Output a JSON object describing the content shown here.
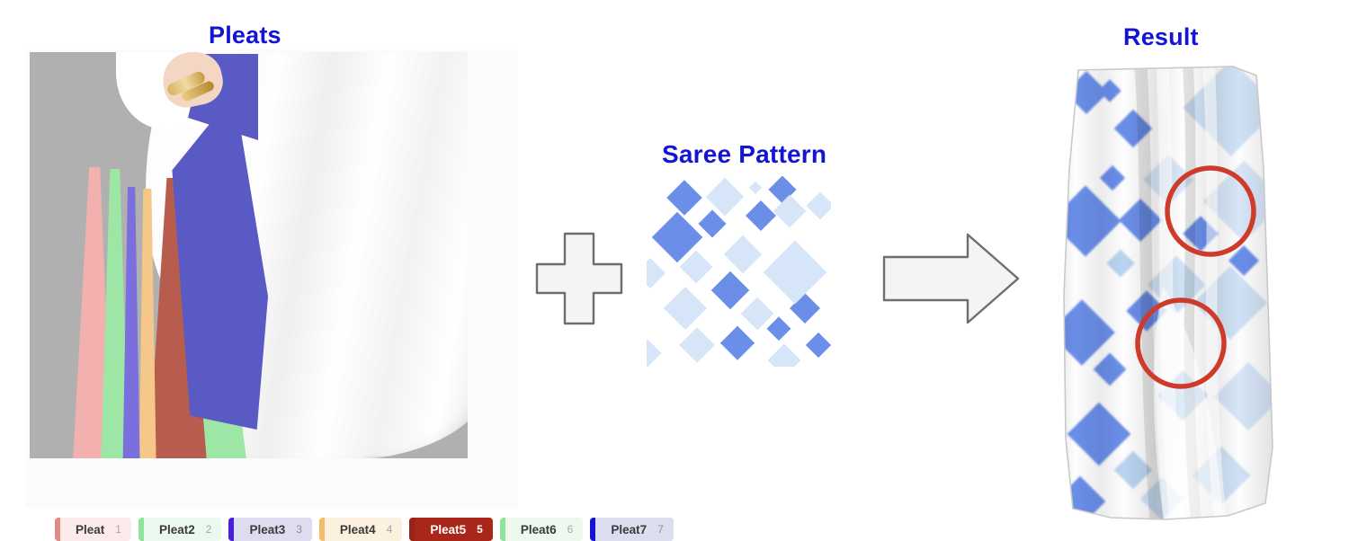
{
  "page": {
    "background": "#ffffff",
    "title_color": "#1414d4"
  },
  "panels": {
    "pleats": {
      "title": "Pleats",
      "canvas_background": "#b0b0b0",
      "legend_label": "Pleat segment legend"
    },
    "pattern": {
      "title": "Saree Pattern",
      "swatch_background": "#ffffff",
      "motif": "diamond",
      "colors": {
        "dark": "#6b8ee8",
        "light": "#d6e5f7",
        "mid": "#b9d4f0"
      }
    },
    "result": {
      "title": "Result",
      "highlight_color": "#cf3b2a",
      "highlight_count": 2
    }
  },
  "operators": {
    "plus": {
      "icon": "plus-icon",
      "fill": "#f4f4f4",
      "stroke": "#6e6e6e"
    },
    "arrow": {
      "icon": "arrow-right-icon",
      "fill": "#f4f4f4",
      "stroke": "#6e6e6e"
    }
  },
  "legend": {
    "chips": [
      {
        "name": "Pleat",
        "index": "1",
        "bar": "#e08a84",
        "bg": "#fbeceb",
        "text": "#3a3a3a",
        "index_color": "#a6a6a6"
      },
      {
        "name": "Pleat2",
        "index": "2",
        "bar": "#8fe39a",
        "bg": "#ecf9ee",
        "text": "#3a3a3a",
        "index_color": "#a6a6a6"
      },
      {
        "name": "Pleat3",
        "index": "3",
        "bar": "#4b1fd6",
        "bg": "#dedcef",
        "text": "#3a3a3a",
        "index_color": "#8e8e9e"
      },
      {
        "name": "Pleat4",
        "index": "4",
        "bar": "#f2bd6a",
        "bg": "#fcf0de",
        "text": "#3a3a3a",
        "index_color": "#a6a6a6"
      },
      {
        "name": "Pleat5",
        "index": "5",
        "bar": "#9b2216",
        "bg": "#a9271a",
        "text": "#ffffff",
        "index_color": "#ffffff"
      },
      {
        "name": "Pleat6",
        "index": "6",
        "bar": "#8fe39a",
        "bg": "#edf8ef",
        "text": "#3a3a3a",
        "index_color": "#a6a6a6"
      },
      {
        "name": "Pleat7",
        "index": "7",
        "bar": "#1414d4",
        "bg": "#dcdeef",
        "text": "#3a3a3a",
        "index_color": "#8e8e9e"
      }
    ]
  },
  "pleat_ribbons": [
    {
      "id": "rb1",
      "color": "#f2b1ae"
    },
    {
      "id": "rb2",
      "color": "#9ee6a5"
    },
    {
      "id": "rb3",
      "color": "#7b6edd"
    },
    {
      "id": "rb4",
      "color": "#f5c889"
    },
    {
      "id": "rb5",
      "color": "#b85c4e"
    },
    {
      "id": "rb6",
      "color": "#9ee6a5"
    },
    {
      "id": "rb7",
      "color": "#5a5ac4"
    }
  ]
}
